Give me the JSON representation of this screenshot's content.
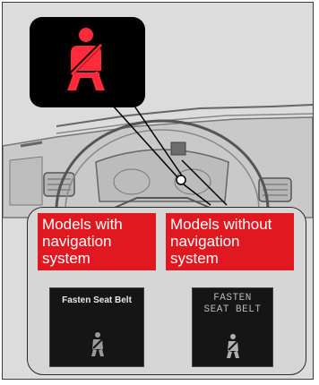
{
  "callout": {
    "icon": "seat-belt-reminder-icon",
    "icon_color": "#ff2a3a",
    "background": "#000000"
  },
  "labels": {
    "with_nav": [
      "Models with",
      "navigation",
      "system"
    ],
    "without_nav": [
      "Models without",
      "navigation",
      "system"
    ],
    "label_color": "#e01820"
  },
  "screens": {
    "nav_message": "Fasten Seat Belt",
    "nonav_message": [
      "FASTEN",
      "SEAT BELT"
    ],
    "icon": "seat-belt-icon"
  }
}
